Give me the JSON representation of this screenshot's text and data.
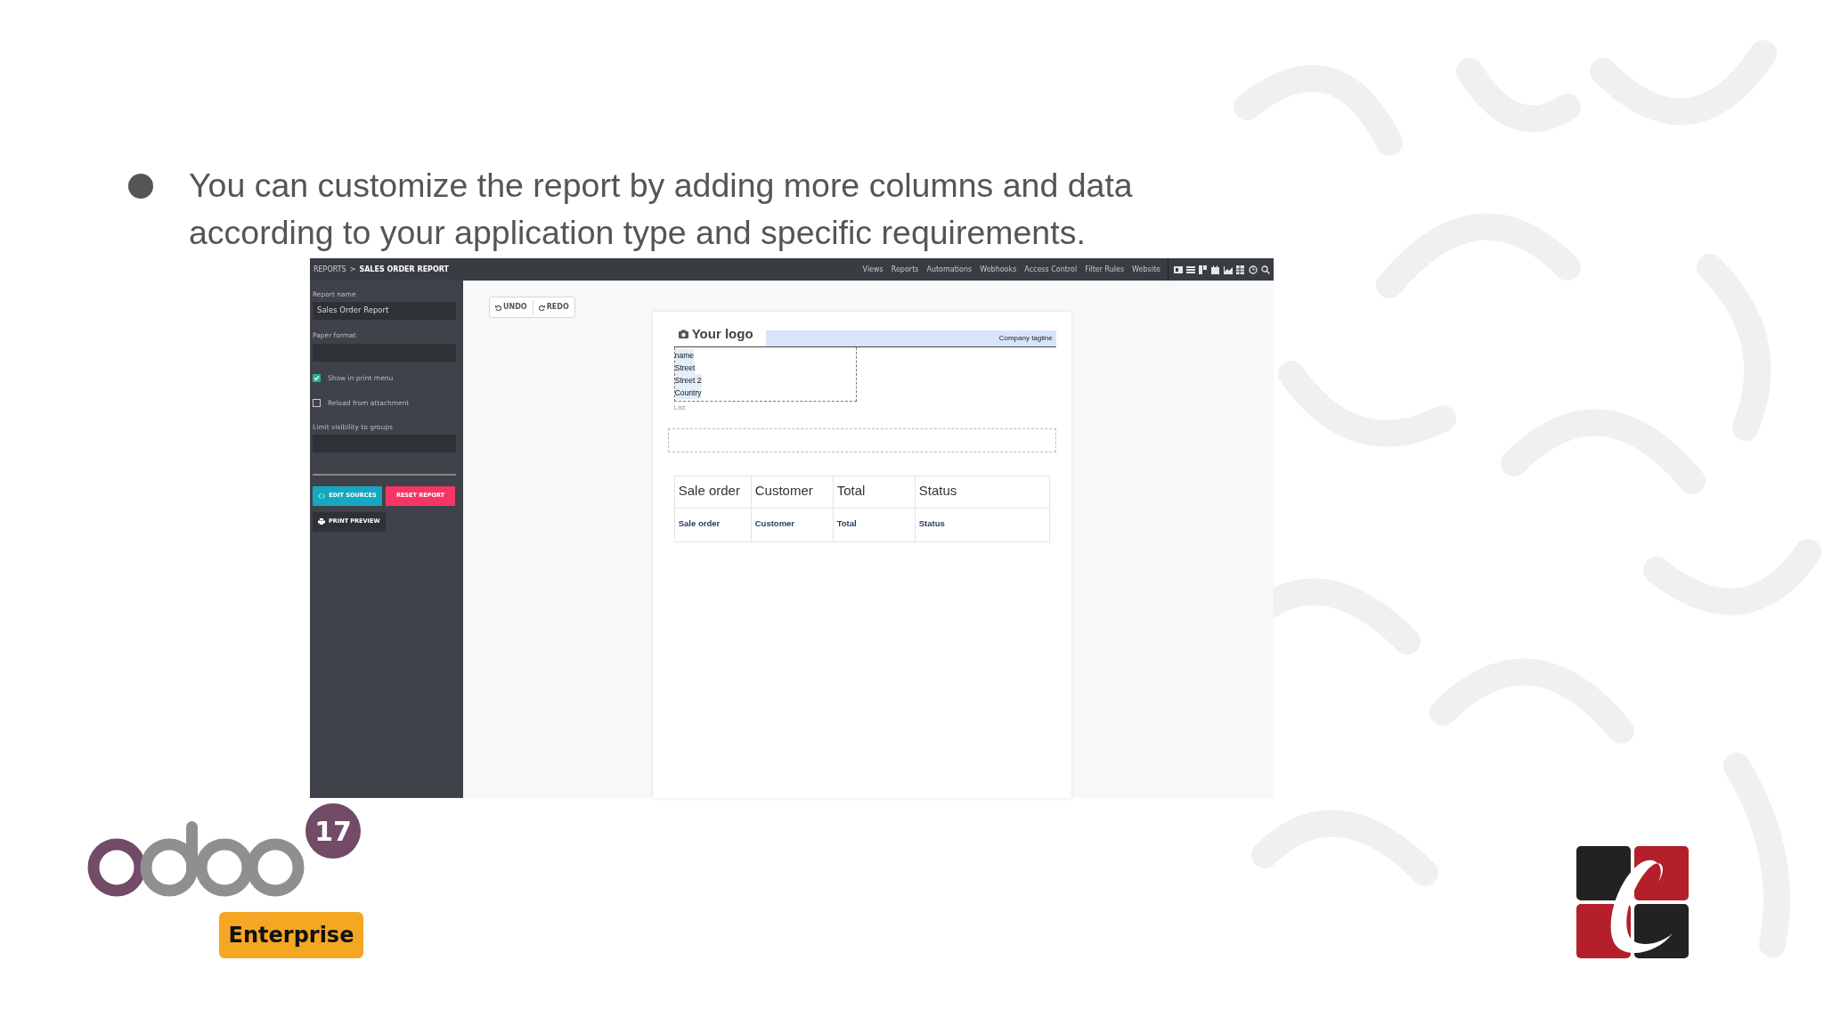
{
  "slide": {
    "bullet": "You can customize the report by adding more columns and data according to your application type and specific requirements."
  },
  "screen": {
    "breadcrumb": {
      "parent": "REPORTS",
      "separator": ">",
      "current": "SALES ORDER REPORT"
    },
    "menu": [
      "Views",
      "Reports",
      "Automations",
      "Webhooks",
      "Access Control",
      "Filter Rules",
      "Website"
    ],
    "sidebar": {
      "fields": [
        {
          "kind": "input",
          "label": "Report name",
          "value": "Sales Order Report"
        },
        {
          "kind": "input",
          "label": "Paper format"
        },
        {
          "kind": "checkbox",
          "label": "Show in print menu",
          "checked": true
        },
        {
          "kind": "checkbox",
          "label": "Reload from attachment",
          "checked": false
        },
        {
          "kind": "input",
          "label": "Limit visibility to groups"
        }
      ],
      "buttons": [
        {
          "label": "EDIT SOURCES",
          "kind": "sources"
        },
        {
          "label": "RESET REPORT",
          "kind": "reset"
        },
        {
          "label": "PRINT PREVIEW",
          "kind": "print"
        }
      ]
    },
    "toolbar": [
      {
        "label": "UNDO",
        "kind": "undo"
      },
      {
        "label": "REDO",
        "kind": "redo"
      }
    ],
    "report": {
      "logo": "Your logo",
      "tagline": "Company tagline",
      "address": [
        "name",
        "Street",
        "Street 2",
        "Country"
      ],
      "address_caption": "List",
      "table": {
        "columns": [
          "Sale order",
          "Customer",
          "Total",
          "Status"
        ],
        "rows": [
          [
            "Sale order",
            "Customer",
            "Total",
            "Status"
          ]
        ]
      }
    }
  },
  "branding": {
    "version": "17",
    "edition": "Enterprise"
  }
}
